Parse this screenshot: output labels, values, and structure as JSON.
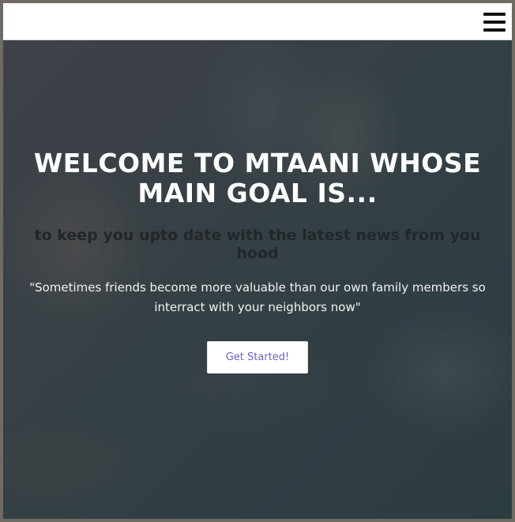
{
  "navbar": {
    "menu_icon": "hamburger-menu-icon"
  },
  "hero": {
    "headline": "WELCOME TO MTAANI WHOSE MAIN GOAL IS...",
    "subheadline": "to keep you upto date with the latest news from you hood",
    "quote": "\"Sometimes friends become more valuable than our own family members so interract with your neighbors now\"",
    "cta_label": "Get Started!"
  },
  "colors": {
    "navbar_bg": "#ffffff",
    "headline": "#ffffff",
    "subheadline": "#22262a",
    "cta_text": "#6a63c9"
  }
}
